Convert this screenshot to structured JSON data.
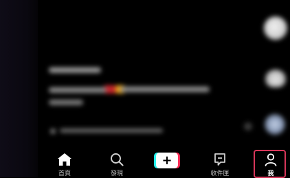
{
  "tabbar": {
    "home_label": "首頁",
    "discover_label": "發現",
    "create_glyph": "+",
    "inbox_label": "收件匣",
    "me_label": "我",
    "active_tab": "me"
  },
  "icons": [
    "home-icon",
    "search-icon",
    "plus-icon",
    "inbox-icon",
    "profile-icon"
  ],
  "colors": {
    "accent_cyan": "#25f4ee",
    "accent_red": "#fe2c55",
    "highlight_border": "#d8365a"
  }
}
